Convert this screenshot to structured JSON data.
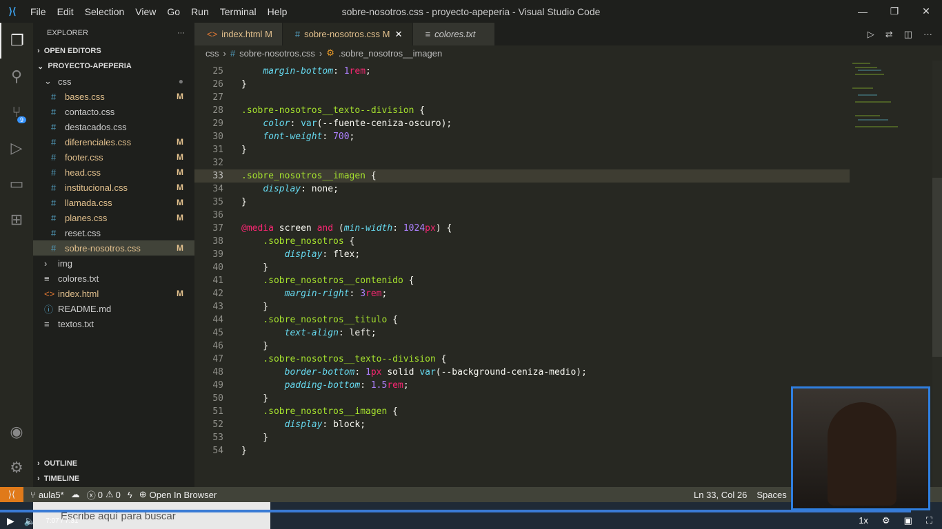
{
  "titlebar": {
    "menu": [
      "File",
      "Edit",
      "Selection",
      "View",
      "Go",
      "Run",
      "Terminal",
      "Help"
    ],
    "title": "sobre-nosotros.css - proyecto-apeperia - Visual Studio Code"
  },
  "activity": {
    "scm_badge": "9"
  },
  "explorer": {
    "title": "EXPLORER",
    "open_editors": "OPEN EDITORS",
    "project": "PROYECTO-APEPERIA",
    "outline": "OUTLINE",
    "timeline": "TIMELINE",
    "tree": [
      {
        "name": "css",
        "type": "folder",
        "depth": 1
      },
      {
        "name": "bases.css",
        "type": "css",
        "depth": 2,
        "mod": "M"
      },
      {
        "name": "contacto.css",
        "type": "css",
        "depth": 2,
        "mod": ""
      },
      {
        "name": "destacados.css",
        "type": "css",
        "depth": 2,
        "mod": ""
      },
      {
        "name": "diferenciales.css",
        "type": "css",
        "depth": 2,
        "mod": "M"
      },
      {
        "name": "footer.css",
        "type": "css",
        "depth": 2,
        "mod": "M"
      },
      {
        "name": "head.css",
        "type": "css",
        "depth": 2,
        "mod": "M"
      },
      {
        "name": "institucional.css",
        "type": "css",
        "depth": 2,
        "mod": "M"
      },
      {
        "name": "llamada.css",
        "type": "css",
        "depth": 2,
        "mod": "M"
      },
      {
        "name": "planes.css",
        "type": "css",
        "depth": 2,
        "mod": "M"
      },
      {
        "name": "reset.css",
        "type": "css",
        "depth": 2,
        "mod": ""
      },
      {
        "name": "sobre-nosotros.css",
        "type": "css",
        "depth": 2,
        "mod": "M",
        "selected": true
      },
      {
        "name": "img",
        "type": "folder-closed",
        "depth": 1
      },
      {
        "name": "colores.txt",
        "type": "txt",
        "depth": 1,
        "mod": ""
      },
      {
        "name": "index.html",
        "type": "html",
        "depth": 1,
        "mod": "M"
      },
      {
        "name": "README.md",
        "type": "md",
        "depth": 1,
        "mod": ""
      },
      {
        "name": "textos.txt",
        "type": "txt",
        "depth": 1,
        "mod": ""
      }
    ]
  },
  "tabs": [
    {
      "label": "index.html",
      "mod": "M",
      "icon": "html-icon"
    },
    {
      "label": "sobre-nosotros.css",
      "mod": "M",
      "icon": "css-icon",
      "active": true
    },
    {
      "label": "colores.txt",
      "icon": "txt-icon"
    }
  ],
  "breadcrumb": [
    "css",
    "sobre-nosotros.css",
    ".sobre_nosotros__imagen"
  ],
  "code": [
    {
      "n": "25",
      "t": [
        [
          "    ",
          ""
        ],
        [
          "margin-bottom",
          "prop"
        ],
        [
          ": ",
          ""
        ],
        [
          "1",
          "num"
        ],
        [
          "rem",
          "unit"
        ],
        [
          ";",
          ""
        ]
      ]
    },
    {
      "n": "26",
      "t": [
        [
          "}",
          ""
        ]
      ]
    },
    {
      "n": "27",
      "t": []
    },
    {
      "n": "28",
      "t": [
        [
          ".sobre-nosotros__texto--division",
          "sel-t"
        ],
        [
          " {",
          ""
        ]
      ]
    },
    {
      "n": "29",
      "t": [
        [
          "    ",
          ""
        ],
        [
          "color",
          "prop"
        ],
        [
          ": ",
          ""
        ],
        [
          "var",
          "fn"
        ],
        [
          "(--fuente-ceniza-oscuro);",
          ""
        ]
      ]
    },
    {
      "n": "30",
      "t": [
        [
          "    ",
          ""
        ],
        [
          "font-weight",
          "prop"
        ],
        [
          ": ",
          ""
        ],
        [
          "700",
          "num"
        ],
        [
          ";",
          ""
        ]
      ]
    },
    {
      "n": "31",
      "t": [
        [
          "}",
          ""
        ]
      ]
    },
    {
      "n": "32",
      "t": []
    },
    {
      "n": "33",
      "t": [
        [
          ".sobre_nosotros__imagen",
          "sel-t"
        ],
        [
          " {",
          ""
        ]
      ],
      "cur": true
    },
    {
      "n": "34",
      "t": [
        [
          "    ",
          ""
        ],
        [
          "display",
          "prop"
        ],
        [
          ": none;",
          ""
        ]
      ]
    },
    {
      "n": "35",
      "t": [
        [
          "}",
          ""
        ]
      ]
    },
    {
      "n": "36",
      "t": []
    },
    {
      "n": "37",
      "t": [
        [
          "@media",
          "kw"
        ],
        [
          " screen ",
          ""
        ],
        [
          "and",
          "kw"
        ],
        [
          " (",
          ""
        ],
        [
          "min-width",
          "prop"
        ],
        [
          ": ",
          ""
        ],
        [
          "1024",
          "num"
        ],
        [
          "px",
          "unit"
        ],
        [
          ") {",
          ""
        ]
      ]
    },
    {
      "n": "38",
      "t": [
        [
          "    ",
          ""
        ],
        [
          ".sobre_nosotros",
          "sel-t"
        ],
        [
          " {",
          ""
        ]
      ]
    },
    {
      "n": "39",
      "t": [
        [
          "        ",
          ""
        ],
        [
          "display",
          "prop"
        ],
        [
          ": flex;",
          ""
        ]
      ]
    },
    {
      "n": "40",
      "t": [
        [
          "    }",
          ""
        ]
      ]
    },
    {
      "n": "41",
      "t": [
        [
          "    ",
          ""
        ],
        [
          ".sobre_nosotros__contenido",
          "sel-t"
        ],
        [
          " {",
          ""
        ]
      ]
    },
    {
      "n": "42",
      "t": [
        [
          "        ",
          ""
        ],
        [
          "margin-right",
          "prop"
        ],
        [
          ": ",
          ""
        ],
        [
          "3",
          "num"
        ],
        [
          "rem",
          "unit"
        ],
        [
          ";",
          ""
        ]
      ]
    },
    {
      "n": "43",
      "t": [
        [
          "    }",
          ""
        ]
      ]
    },
    {
      "n": "44",
      "t": [
        [
          "    ",
          ""
        ],
        [
          ".sobre_nosotros__titulo",
          "sel-t"
        ],
        [
          " {",
          ""
        ]
      ]
    },
    {
      "n": "45",
      "t": [
        [
          "        ",
          ""
        ],
        [
          "text-align",
          "prop"
        ],
        [
          ": left;",
          ""
        ]
      ]
    },
    {
      "n": "46",
      "t": [
        [
          "    }",
          ""
        ]
      ]
    },
    {
      "n": "47",
      "t": [
        [
          "    ",
          ""
        ],
        [
          ".sobre-nosotros__texto--division",
          "sel-t"
        ],
        [
          " {",
          ""
        ]
      ]
    },
    {
      "n": "48",
      "t": [
        [
          "        ",
          ""
        ],
        [
          "border-bottom",
          "prop"
        ],
        [
          ": ",
          ""
        ],
        [
          "1",
          "num"
        ],
        [
          "px",
          "unit"
        ],
        [
          " solid ",
          ""
        ],
        [
          "var",
          "fn"
        ],
        [
          "(--background-ceniza-medio);",
          ""
        ]
      ]
    },
    {
      "n": "49",
      "t": [
        [
          "        ",
          ""
        ],
        [
          "padding-bottom",
          "prop"
        ],
        [
          ": ",
          ""
        ],
        [
          "1.5",
          "num"
        ],
        [
          "rem",
          "unit"
        ],
        [
          ";",
          ""
        ]
      ]
    },
    {
      "n": "50",
      "t": [
        [
          "    }",
          ""
        ]
      ]
    },
    {
      "n": "51",
      "t": [
        [
          "    ",
          ""
        ],
        [
          ".sobre_nosotros__imagen",
          "sel-t"
        ],
        [
          " {",
          ""
        ]
      ]
    },
    {
      "n": "52",
      "t": [
        [
          "        ",
          ""
        ],
        [
          "display",
          "prop"
        ],
        [
          ": block;",
          ""
        ]
      ]
    },
    {
      "n": "53",
      "t": [
        [
          "    }",
          ""
        ]
      ]
    },
    {
      "n": "54",
      "t": [
        [
          "}",
          ""
        ]
      ]
    }
  ],
  "status": {
    "branch": "aula5*",
    "errors": "0",
    "warnings": "0",
    "open_browser": "Open In Browser",
    "position": "Ln 33, Col 26",
    "indent": "Spaces"
  },
  "taskbar": {
    "search_placeholder": "Escribe aquí para buscar"
  },
  "video": {
    "time": "7:07 / 7:31",
    "speed": "1x",
    "progress": 0.967
  }
}
